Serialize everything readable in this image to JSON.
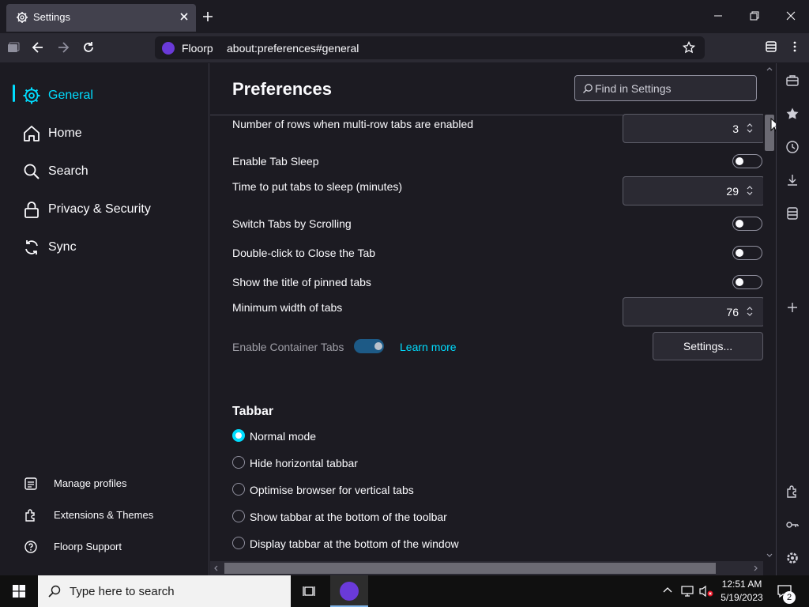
{
  "window": {
    "tab_title": "Settings"
  },
  "navbar": {
    "brand": "Floorp",
    "url": "about:preferences#general"
  },
  "sidebar": {
    "categories": [
      {
        "label": "General",
        "icon": "gear-icon",
        "selected": true
      },
      {
        "label": "Home",
        "icon": "home-icon"
      },
      {
        "label": "Search",
        "icon": "search-icon"
      },
      {
        "label": "Privacy & Security",
        "icon": "lock-icon"
      },
      {
        "label": "Sync",
        "icon": "sync-icon"
      }
    ],
    "footer": [
      {
        "label": "Manage profiles",
        "icon": "profiles-icon"
      },
      {
        "label": "Extensions & Themes",
        "icon": "puzzle-icon"
      },
      {
        "label": "Floorp Support",
        "icon": "help-icon"
      }
    ]
  },
  "main": {
    "title": "Preferences",
    "search_placeholder": "Find in Settings",
    "settings": {
      "rows_label": "Number of rows when multi-row tabs are enabled",
      "rows_value": "3",
      "tab_sleep_label": "Enable Tab Sleep",
      "sleep_time_label": "Time to put tabs to sleep (minutes)",
      "sleep_time_value": "29",
      "switch_scroll_label": "Switch Tabs by Scrolling",
      "dblclick_close_label": "Double-click to Close the Tab",
      "pinned_title_label": "Show the title of pinned tabs",
      "min_width_label": "Minimum width of tabs",
      "min_width_value": "76",
      "container_label": "Enable Container Tabs",
      "container_learn_more": "Learn more",
      "container_settings_btn": "Settings..."
    },
    "tabbar": {
      "heading": "Tabbar",
      "options": [
        {
          "label": "Normal mode",
          "selected": true
        },
        {
          "label": "Hide horizontal tabbar",
          "selected": false
        },
        {
          "label": "Optimise browser for vertical tabs",
          "selected": false
        },
        {
          "label": "Show tabbar at the bottom of the toolbar",
          "selected": false
        },
        {
          "label": "Display tabbar at the bottom of the window",
          "selected": false
        }
      ]
    }
  },
  "taskbar": {
    "search_placeholder": "Type here to search",
    "time": "12:51 AM",
    "date": "5/19/2023",
    "notification_count": "2"
  },
  "colors": {
    "accent": "#00ddff",
    "background": "#1c1b22",
    "toolbar": "#2b2a33"
  }
}
